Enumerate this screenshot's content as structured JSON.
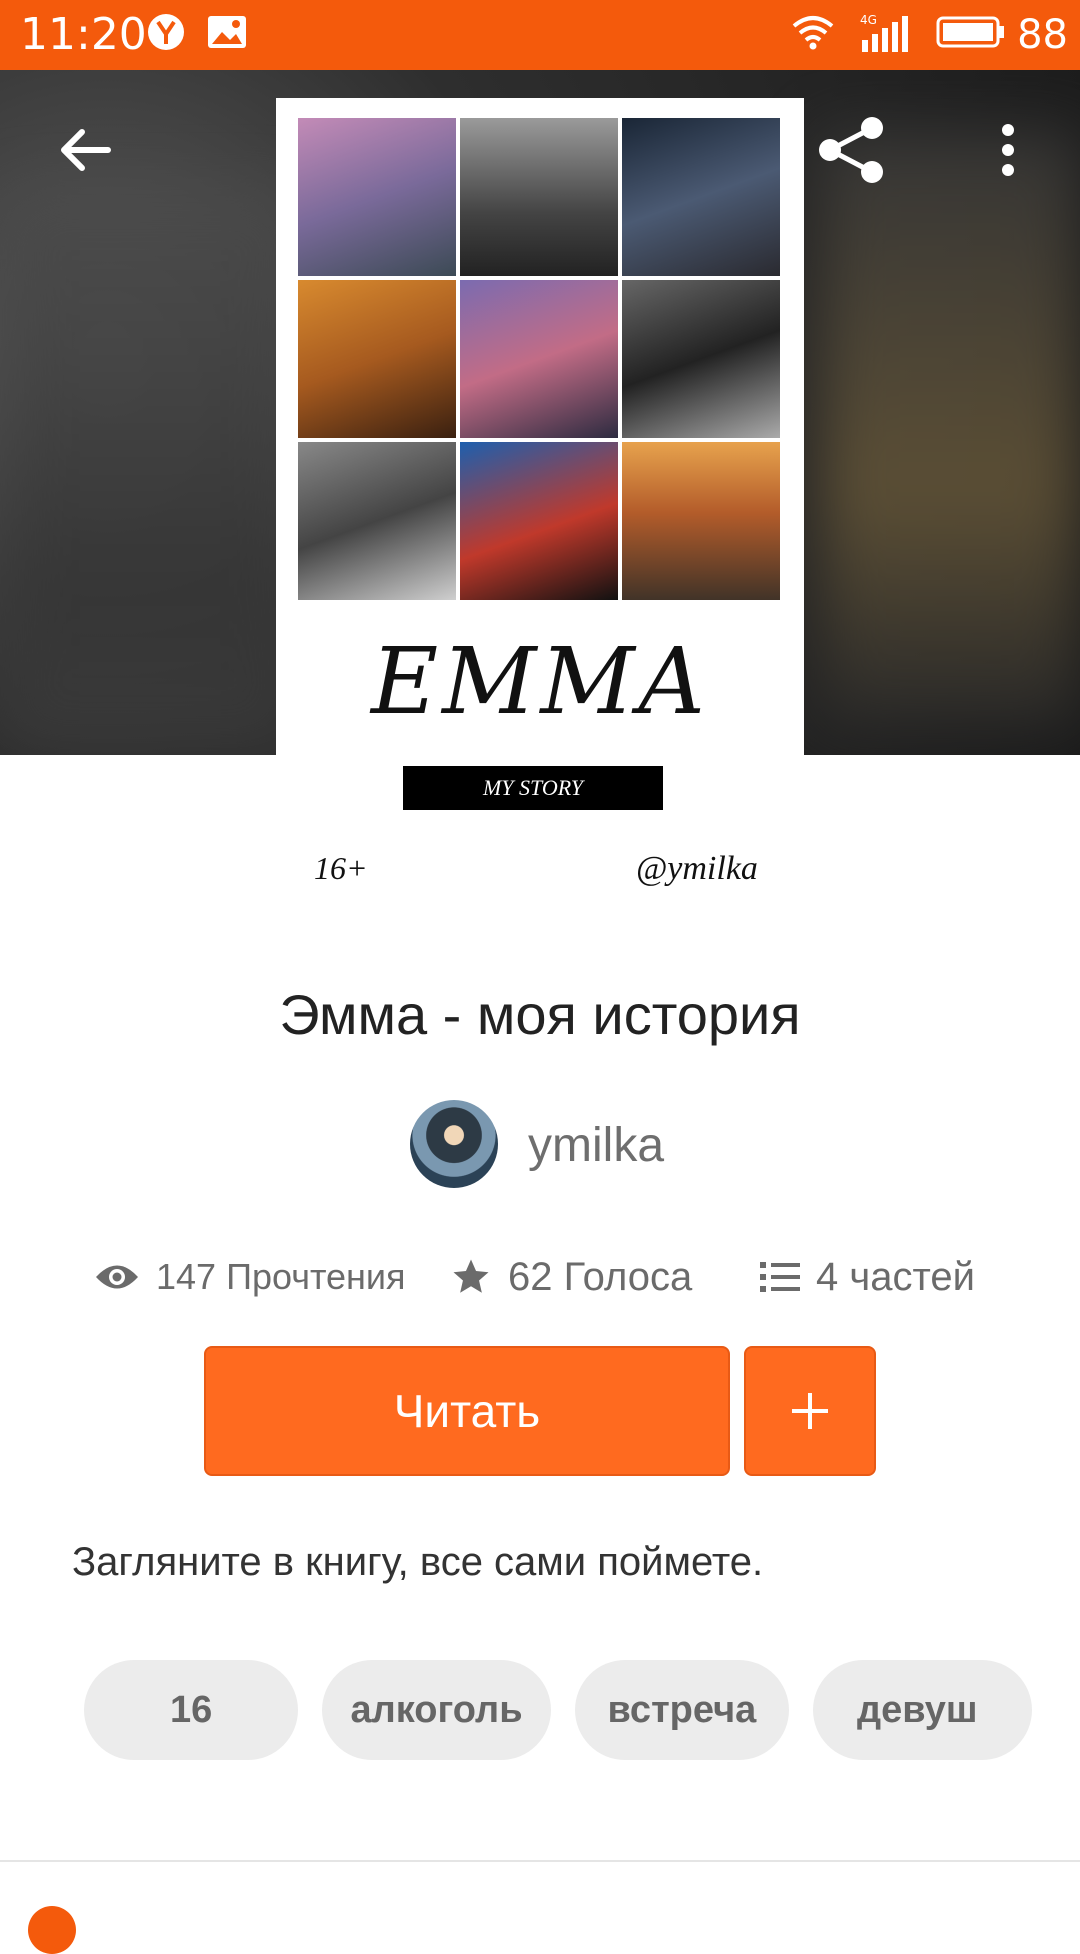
{
  "status_bar": {
    "time": "11:20",
    "network": "4G",
    "battery": "88"
  },
  "cover": {
    "title_art": "EMMA",
    "subtitle_badge": "MY STORY",
    "age_rating": "16+",
    "handle": "@ymilka"
  },
  "story": {
    "title": "Эмма - моя история",
    "author": "ymilka",
    "stats": {
      "reads": "147 Прочтения",
      "votes": "62 Голоса",
      "parts": "4 частей"
    },
    "read_button": "Читать",
    "add_button": "+",
    "description": "Загляните в книгу, все сами поймете.",
    "tags": [
      "16",
      "алкоголь",
      "встреча",
      "девуш"
    ]
  },
  "colors": {
    "accent": "#f45a0c",
    "button": "#ff6a1f",
    "tag_bg": "#ececec"
  }
}
